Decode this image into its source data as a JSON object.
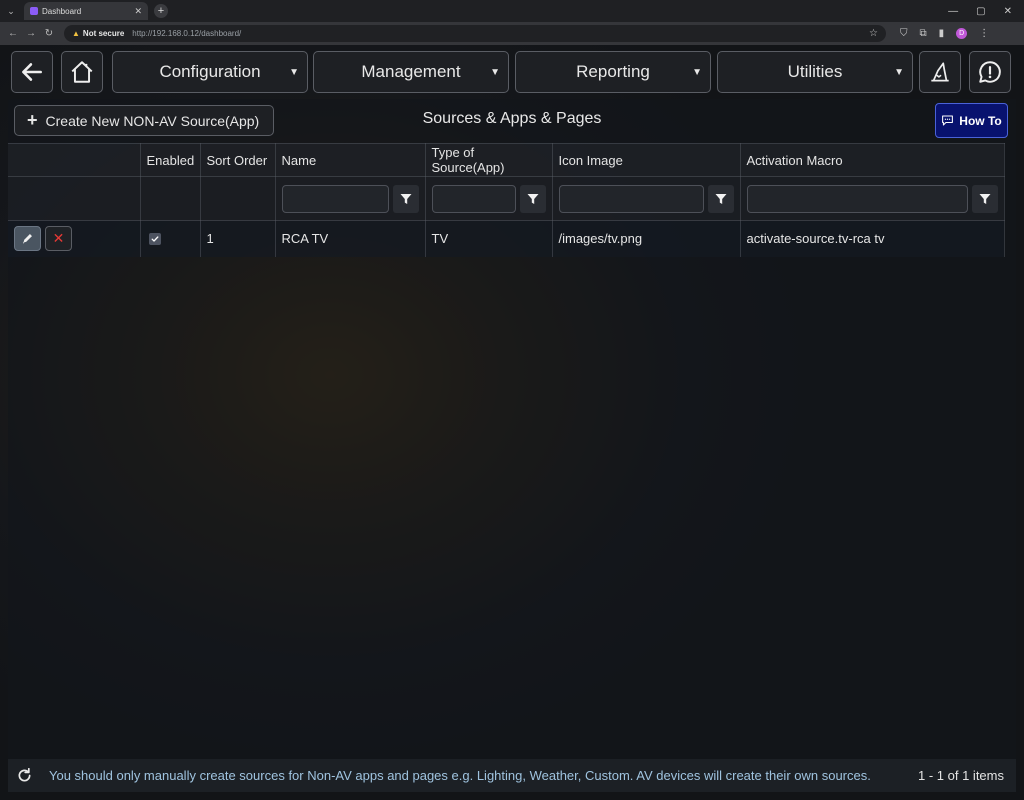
{
  "browser": {
    "tab_title": "Dashboard",
    "security_label": "Not secure",
    "url": "http://192.168.0.12/dashboard/",
    "profile_initial": "D"
  },
  "nav": {
    "menus": [
      {
        "label": "Configuration"
      },
      {
        "label": "Management"
      },
      {
        "label": "Reporting"
      },
      {
        "label": "Utilities"
      }
    ]
  },
  "toolbar": {
    "create_label": "Create New NON-AV Source(App)",
    "title": "Sources & Apps & Pages",
    "howto_label": "How To"
  },
  "grid": {
    "columns": [
      "",
      "Enabled",
      "Sort Order",
      "Name",
      "Type of Source(App)",
      "Icon Image",
      "Activation Macro"
    ],
    "rows": [
      {
        "enabled": true,
        "sort_order": "1",
        "name": "RCA TV",
        "type": "TV",
        "icon_image": "/images/tv.png",
        "activation_macro": "activate-source.tv-rca tv"
      }
    ]
  },
  "footer": {
    "note": "You should only manually create sources for Non-AV apps and pages e.g. Lighting, Weather, Custom. AV devices will create their own sources.",
    "pager": "1 - 1 of 1 items"
  },
  "colors": {
    "howto_bg": "#08126e",
    "delete_icon": "#e53935",
    "footer_note": "#9fc3df"
  }
}
